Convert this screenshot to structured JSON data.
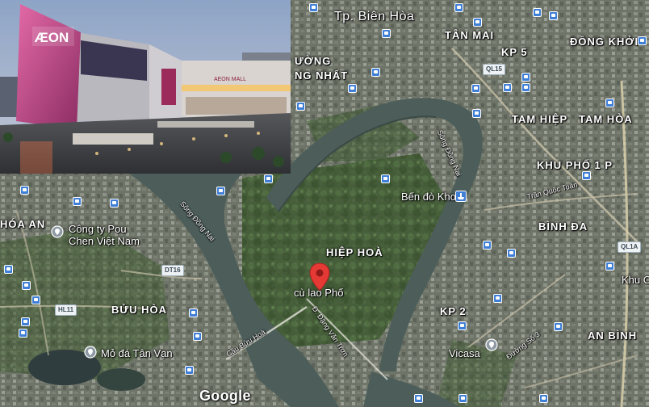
{
  "map": {
    "labels": {
      "city": "Tp. Biên Hòa",
      "tan_mai": "TÂN MAI",
      "dong_khoi": "ĐỒNG KHỞI",
      "kp5": "KP 5",
      "thong_nhat_line1": "ƯỜNG",
      "thong_nhat_line2": "NG NHẤT",
      "tam_hiep": "TAM HIỆP",
      "tam_hoa": "TAM HÒA",
      "khu_pho_1": "KHU PHỐ 1 P",
      "hoa_an": "HÓA AN",
      "hiep_hoa": "HIỆP HOÀ",
      "binh_da": "BÌNH ĐA",
      "buu_hoa": "BỬU HÒA",
      "kp2": "KP 2",
      "an_binh": "AN BÌNH",
      "khu_c": "Khu C"
    },
    "roads": {
      "river1": "Sông Đồng Nai",
      "river2": "Sông Đồng Nai",
      "tran_quoc_toan": "Trần Quốc Toản",
      "cau_buu_hoa": "Cầu Bửu Hoà",
      "dang_van_tron": "Đ. Đặng Văn Trơn",
      "duong_so_3": "Đường Số 3"
    },
    "shields": {
      "ql15": "QL15",
      "dt16": "DT16",
      "hl11": "HL11",
      "ql1a": "QL1A"
    },
    "pois": {
      "pou_chen_line1": "Công ty Pou",
      "pou_chen_line2": "Chen Việt Nam",
      "ben_do_kho": "Bến đò Kho",
      "cu_lao_pho": "cù lao Phố",
      "mo_da_tan_van": "Mỏ đá Tân Vạn",
      "vicasa": "Vicasa"
    },
    "watermark": "Google"
  },
  "photo": {
    "store_sign": "ÆON",
    "store_sign_2": "AEON MALL"
  },
  "colors": {
    "pin_red": "#e53935",
    "bus_blue": "#3f7fd6",
    "poi_grey": "#8e9aa3"
  }
}
